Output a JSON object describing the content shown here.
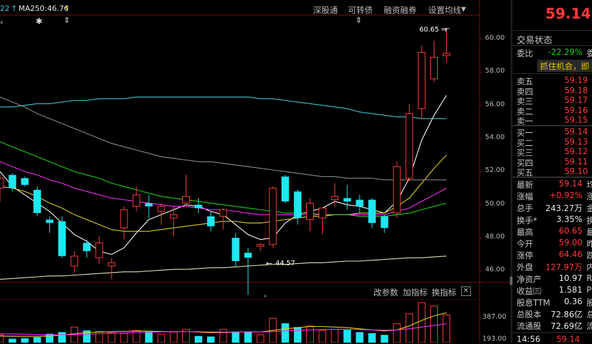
{
  "indicators": {
    "ma_prefix": "22",
    "ma250_label": "MA250:46.76"
  },
  "toolbar": {
    "shenzhen": "深股通",
    "convertible": "可转债",
    "margin": "融资融券",
    "set_ma": "设置均线"
  },
  "volume_toolbar": {
    "change_params": "改参数",
    "add_indicator": "加指标",
    "switch_indicator": "换指标"
  },
  "markers": {
    "high_label": "60.65",
    "low_label": "44.57"
  },
  "price_axis": [
    "60.00",
    "58.00",
    "56.00",
    "54.00",
    "52.00",
    "50.00",
    "48.00",
    "46.00"
  ],
  "volume_axis": [
    "387.00",
    "193.00"
  ],
  "right_panel": {
    "price": "59.14",
    "trade_status": "交易状态",
    "weibi_label": "委比",
    "weibi_value": "-22.29%",
    "weibi_edge": "委",
    "slogan": "抓住机会，即",
    "asks": [
      {
        "label": "卖五",
        "price": "59.19"
      },
      {
        "label": "卖四",
        "price": "59.18"
      },
      {
        "label": "卖三",
        "price": "59.17"
      },
      {
        "label": "卖二",
        "price": "59.16"
      },
      {
        "label": "卖一",
        "price": "59.15"
      }
    ],
    "bids": [
      {
        "label": "买一",
        "price": "59.14"
      },
      {
        "label": "买二",
        "price": "59.13"
      },
      {
        "label": "买三",
        "price": "59.12"
      },
      {
        "label": "买四",
        "price": "59.11"
      },
      {
        "label": "买五",
        "price": "59.10"
      }
    ],
    "stats": [
      {
        "label": "最新",
        "value": "59.14",
        "color": "red",
        "edge": "均"
      },
      {
        "label": "涨幅",
        "value": "+0.92%",
        "color": "red",
        "edge": "涨"
      },
      {
        "label": "总手",
        "value": "243.27万",
        "color": "white",
        "edge": "金"
      },
      {
        "label": "换手*",
        "value": "3.35%",
        "color": "white",
        "edge": "换"
      },
      {
        "label": "最高",
        "value": "60.65",
        "color": "red",
        "edge": "最"
      },
      {
        "label": "今开",
        "value": "59.00",
        "color": "red",
        "edge": "昨"
      },
      {
        "label": "涨停",
        "value": "64.46",
        "color": "red",
        "edge": "跌"
      },
      {
        "label": "外盘",
        "value": "127.97万",
        "color": "red",
        "edge": "内"
      },
      {
        "label": "净资产",
        "value": "10.97",
        "color": "white",
        "edge": "R"
      },
      {
        "label": "收益㈢",
        "value": "1.581",
        "color": "white",
        "edge": "P"
      },
      {
        "label": "股息TTM",
        "value": "0.36",
        "color": "white",
        "edge": "股"
      },
      {
        "label": "总股本",
        "value": "72.86亿",
        "color": "white",
        "edge": "总"
      },
      {
        "label": "流通股",
        "value": "72.69亿",
        "color": "white",
        "edge": "流"
      }
    ],
    "time": "14:56",
    "time_price": "59.14"
  },
  "chart_data": {
    "type": "candlestick",
    "price_axis": {
      "min": 45.4,
      "max": 61.2,
      "ticks": [
        60,
        58,
        56,
        54,
        52,
        50,
        48,
        46
      ]
    },
    "volume_axis": {
      "ticks": [
        387.0,
        193.0
      ]
    },
    "annotations": [
      {
        "text": "60.65",
        "value": 60.65
      },
      {
        "text": "44.57",
        "value": 44.57
      }
    ],
    "candles": [
      {
        "o": 51.0,
        "h": 51.8,
        "l": 50.2,
        "c": 51.6
      },
      {
        "o": 51.8,
        "h": 51.9,
        "l": 50.8,
        "c": 51.0
      },
      {
        "o": 51.6,
        "h": 51.7,
        "l": 51.1,
        "c": 51.2
      },
      {
        "o": 50.9,
        "h": 51.1,
        "l": 49.3,
        "c": 49.5
      },
      {
        "o": 49.1,
        "h": 49.3,
        "l": 48.3,
        "c": 48.9
      },
      {
        "o": 49.0,
        "h": 49.3,
        "l": 46.8,
        "c": 46.9
      },
      {
        "o": 46.3,
        "h": 47.2,
        "l": 45.9,
        "c": 46.9
      },
      {
        "o": 47.7,
        "h": 47.9,
        "l": 46.8,
        "c": 47.2
      },
      {
        "o": 46.8,
        "h": 48.1,
        "l": 46.4,
        "c": 47.7
      },
      {
        "o": 46.3,
        "h": 46.8,
        "l": 45.5,
        "c": 46.5
      },
      {
        "o": 48.6,
        "h": 49.9,
        "l": 47.9,
        "c": 49.7
      },
      {
        "o": 49.9,
        "h": 51.1,
        "l": 49.6,
        "c": 50.6
      },
      {
        "o": 50.1,
        "h": 50.6,
        "l": 49.2,
        "c": 49.9
      },
      {
        "o": 49.6,
        "h": 50.1,
        "l": 48.8,
        "c": 49.9
      },
      {
        "o": 49.2,
        "h": 49.9,
        "l": 48.1,
        "c": 49.4
      },
      {
        "o": 50.1,
        "h": 51.8,
        "l": 50.0,
        "c": 50.5
      },
      {
        "o": 50.0,
        "h": 50.4,
        "l": 49.5,
        "c": 49.8
      },
      {
        "o": 49.3,
        "h": 49.6,
        "l": 48.4,
        "c": 48.7
      },
      {
        "o": 49.3,
        "h": 49.8,
        "l": 48.5,
        "c": 49.7
      },
      {
        "o": 48.0,
        "h": 48.3,
        "l": 46.3,
        "c": 46.6
      },
      {
        "o": 47.1,
        "h": 47.4,
        "l": 44.57,
        "c": 46.8
      },
      {
        "o": 47.5,
        "h": 47.7,
        "l": 47.2,
        "c": 47.6
      },
      {
        "o": 47.6,
        "h": 51.1,
        "l": 47.4,
        "c": 51.0
      },
      {
        "o": 51.7,
        "h": 51.8,
        "l": 50.1,
        "c": 50.2
      },
      {
        "o": 50.8,
        "h": 50.9,
        "l": 48.8,
        "c": 49.2
      },
      {
        "o": 49.1,
        "h": 50.4,
        "l": 48.4,
        "c": 50.1
      },
      {
        "o": 49.2,
        "h": 49.8,
        "l": 48.2,
        "c": 49.8
      },
      {
        "o": 50.3,
        "h": 51.3,
        "l": 49.9,
        "c": 50.5
      },
      {
        "o": 50.4,
        "h": 51.2,
        "l": 49.7,
        "c": 50.2
      },
      {
        "o": 50.3,
        "h": 50.6,
        "l": 49.5,
        "c": 49.9
      },
      {
        "o": 50.3,
        "h": 50.4,
        "l": 48.6,
        "c": 48.9
      },
      {
        "o": 49.3,
        "h": 49.4,
        "l": 48.3,
        "c": 48.6
      },
      {
        "o": 49.5,
        "h": 52.6,
        "l": 49.2,
        "c": 52.3
      },
      {
        "o": 51.6,
        "h": 56.1,
        "l": 51.4,
        "c": 55.5
      },
      {
        "o": 55.8,
        "h": 59.6,
        "l": 55.2,
        "c": 59.2
      },
      {
        "o": 57.6,
        "h": 59.9,
        "l": 57.4,
        "c": 58.9
      },
      {
        "o": 59.0,
        "h": 60.65,
        "l": 58.6,
        "c": 59.14
      }
    ],
    "ma_lines": [
      {
        "color": "#ffffff",
        "values": [
          52.0,
          51.1,
          50.6,
          50.1,
          49.6,
          48.9,
          48.2,
          47.8,
          47.2,
          47.0,
          47.4,
          48.3,
          49.1,
          49.4,
          49.7,
          50.0,
          49.9,
          49.6,
          49.4,
          48.8,
          48.2,
          47.9,
          48.0,
          48.9,
          49.4,
          49.6,
          49.8,
          50.2,
          50.0,
          49.9,
          49.7,
          49.5,
          50.2,
          51.6,
          53.9,
          55.4,
          56.6
        ]
      },
      {
        "color": "#e5d21e",
        "values": [
          51.1,
          51.0,
          50.8,
          50.5,
          50.1,
          49.8,
          49.4,
          49.1,
          48.8,
          48.5,
          48.4,
          48.4,
          48.4,
          48.5,
          48.6,
          48.7,
          48.8,
          48.9,
          49.0,
          49.0,
          48.9,
          48.9,
          49.0,
          49.1,
          49.2,
          49.3,
          49.3,
          49.4,
          49.4,
          49.5,
          49.5,
          49.5,
          49.9,
          50.4,
          51.3,
          52.2,
          53.0
        ]
      },
      {
        "color": "#ff2aff",
        "values": [
          52.6,
          52.3,
          52.0,
          51.8,
          51.5,
          51.3,
          51.0,
          50.8,
          50.6,
          50.4,
          50.3,
          50.2,
          50.1,
          50.0,
          49.9,
          49.9,
          49.8,
          49.7,
          49.7,
          49.6,
          49.5,
          49.4,
          49.4,
          49.4,
          49.4,
          49.4,
          49.4,
          49.4,
          49.4,
          49.4,
          49.4,
          49.4,
          49.6,
          49.8,
          50.2,
          50.6,
          51.0
        ]
      },
      {
        "color": "#1ed21e",
        "values": [
          53.8,
          53.5,
          53.2,
          52.9,
          52.6,
          52.3,
          52.0,
          51.8,
          51.6,
          51.3,
          51.1,
          50.9,
          50.7,
          50.5,
          50.4,
          50.3,
          50.2,
          50.1,
          50.0,
          49.9,
          49.8,
          49.7,
          49.6,
          49.5,
          49.5,
          49.5,
          49.4,
          49.4,
          49.4,
          49.3,
          49.3,
          49.3,
          49.4,
          49.5,
          49.7,
          49.9,
          50.1
        ]
      },
      {
        "color": "#8c8c8c",
        "values": [
          56.5,
          56.2,
          55.9,
          55.5,
          55.2,
          54.9,
          54.6,
          54.3,
          54.0,
          53.7,
          53.5,
          53.3,
          53.1,
          52.9,
          52.8,
          52.7,
          52.6,
          52.6,
          52.5,
          52.4,
          52.3,
          52.2,
          52.1,
          52.0,
          51.9,
          51.8,
          51.7,
          51.7,
          51.6,
          51.6,
          51.6,
          51.5,
          51.5,
          51.5,
          51.5,
          51.5,
          51.5
        ]
      },
      {
        "color": "#3fc6d6",
        "values": [
          55.9,
          55.9,
          56.0,
          56.1,
          56.1,
          56.2,
          56.3,
          56.3,
          56.4,
          56.4,
          56.4,
          56.5,
          56.5,
          56.5,
          56.5,
          56.5,
          56.5,
          56.5,
          56.5,
          56.5,
          56.5,
          56.4,
          56.4,
          56.3,
          56.2,
          56.1,
          56.0,
          55.9,
          55.8,
          55.6,
          55.5,
          55.4,
          55.3,
          55.3,
          55.2,
          55.2,
          55.2
        ]
      },
      {
        "color": "#e8e3b0",
        "values": [
          45.5,
          45.55,
          45.6,
          45.65,
          45.7,
          45.7,
          45.75,
          45.8,
          45.85,
          45.9,
          45.95,
          45.95,
          46.0,
          46.05,
          46.1,
          46.1,
          46.15,
          46.2,
          46.2,
          46.25,
          46.3,
          46.35,
          46.4,
          46.4,
          46.45,
          46.5,
          46.5,
          46.55,
          46.6,
          46.6,
          46.65,
          46.7,
          46.75,
          46.8,
          46.8,
          46.85,
          46.9
        ]
      }
    ],
    "volumes": [
      70,
      35,
      40,
      50,
      80,
      95,
      140,
      110,
      100,
      90,
      85,
      110,
      100,
      75,
      95,
      120,
      60,
      55,
      120,
      100,
      100,
      70,
      220,
      175,
      140,
      150,
      110,
      120,
      115,
      95,
      85,
      70,
      170,
      260,
      360,
      330,
      250
    ],
    "volume_ma": [
      {
        "color": "#e5d21e",
        "values": [
          60,
          58,
          55,
          56,
          60,
          68,
          80,
          90,
          95,
          100,
          102,
          105,
          104,
          100,
          98,
          100,
          95,
          90,
          92,
          95,
          98,
          95,
          110,
          125,
          135,
          145,
          145,
          140,
          135,
          125,
          115,
          105,
          115,
          150,
          200,
          240,
          270
        ]
      },
      {
        "color": "#ff2aff",
        "values": [
          80,
          78,
          75,
          72,
          70,
          70,
          72,
          75,
          80,
          85,
          88,
          92,
          95,
          97,
          98,
          99,
          98,
          97,
          96,
          96,
          97,
          96,
          100,
          105,
          110,
          115,
          118,
          120,
          120,
          118,
          115,
          112,
          115,
          125,
          140,
          155,
          170
        ]
      }
    ]
  }
}
